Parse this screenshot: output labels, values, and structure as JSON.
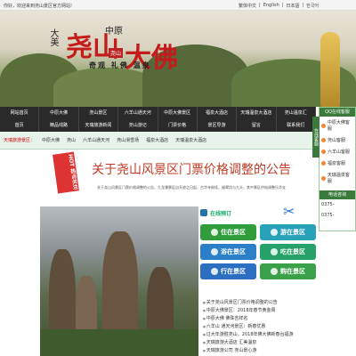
{
  "topbar": {
    "welcome": "你好，欢迎来到尧山景区官方网站!",
    "langs": [
      "繁体中文",
      "English",
      "日本語",
      "한국어"
    ]
  },
  "banner": {
    "logo_a": "大美",
    "logo_b": "尧山",
    "logo_c": "中原",
    "logo_d": "大佛",
    "seal": "尧山",
    "tagline": "奇观 礼佛 温泉"
  },
  "nav": {
    "row1": [
      "网站首页",
      "中原大佛",
      "尧山景区",
      "六羊山通天河",
      "中原大佛景区",
      "福泉大酒店",
      "天瑞温泉大酒店",
      "尧山温泉汇"
    ],
    "row2": [
      "首页",
      "精品线路",
      "天瑞旅游新闻",
      "尧山游记",
      "门票价格",
      "景区导游",
      "留言",
      "联系我们"
    ]
  },
  "subnav": {
    "label": "天瑞旅游景区：",
    "items": [
      "中原大佛",
      "尧山",
      "六羊山通天河",
      "尧山滑雪场",
      "福泉大酒店",
      "天瑞温泉大酒店"
    ]
  },
  "sidebar": {
    "head": "QQ在线客服",
    "tab": "在线客服",
    "qq": [
      "中原大佛客服",
      "尧山客服",
      "六羊山客服",
      "福泉客服",
      "天瑞温泉客服"
    ],
    "phone_head": "电话咨询",
    "phones": [
      "0375-",
      "0375-"
    ]
  },
  "hot": "HOT 热点关注",
  "notice": {
    "title": "关于尧山风景区门票价格调整的公告",
    "body": "关于尧山风景区门票价格调整的公告，九龙瀑景区自开放之日起，古华寺继续，福鹭坊与九头，其中景区供电调整乐华支"
  },
  "booking": {
    "title": "在线预订",
    "buttons": [
      {
        "label": "住在景区",
        "color": "#2f9e3a"
      },
      {
        "label": "游在景区",
        "color": "#29a1b8"
      },
      {
        "label": "浴在景区",
        "color": "#2a7fc8"
      },
      {
        "label": "吃在景区",
        "color": "#26a268"
      },
      {
        "label": "行在景区",
        "color": "#2c6fc0"
      },
      {
        "label": "购在景区",
        "color": "#3aa04a"
      }
    ]
  },
  "news": [
    "关于尧山风景区门票价格调整的公告",
    "中原大佛景区：2018年春节黄金周",
    "中原大佛 佛珠吉祥名",
    "六羊山 通天河景区：新春优惠",
    "过大年游胜尧山，2018年佛大佛新春台福游",
    "天瑞旅游大酒店 汇美温泉",
    "天瑞旅游公司 尧山景心游"
  ]
}
